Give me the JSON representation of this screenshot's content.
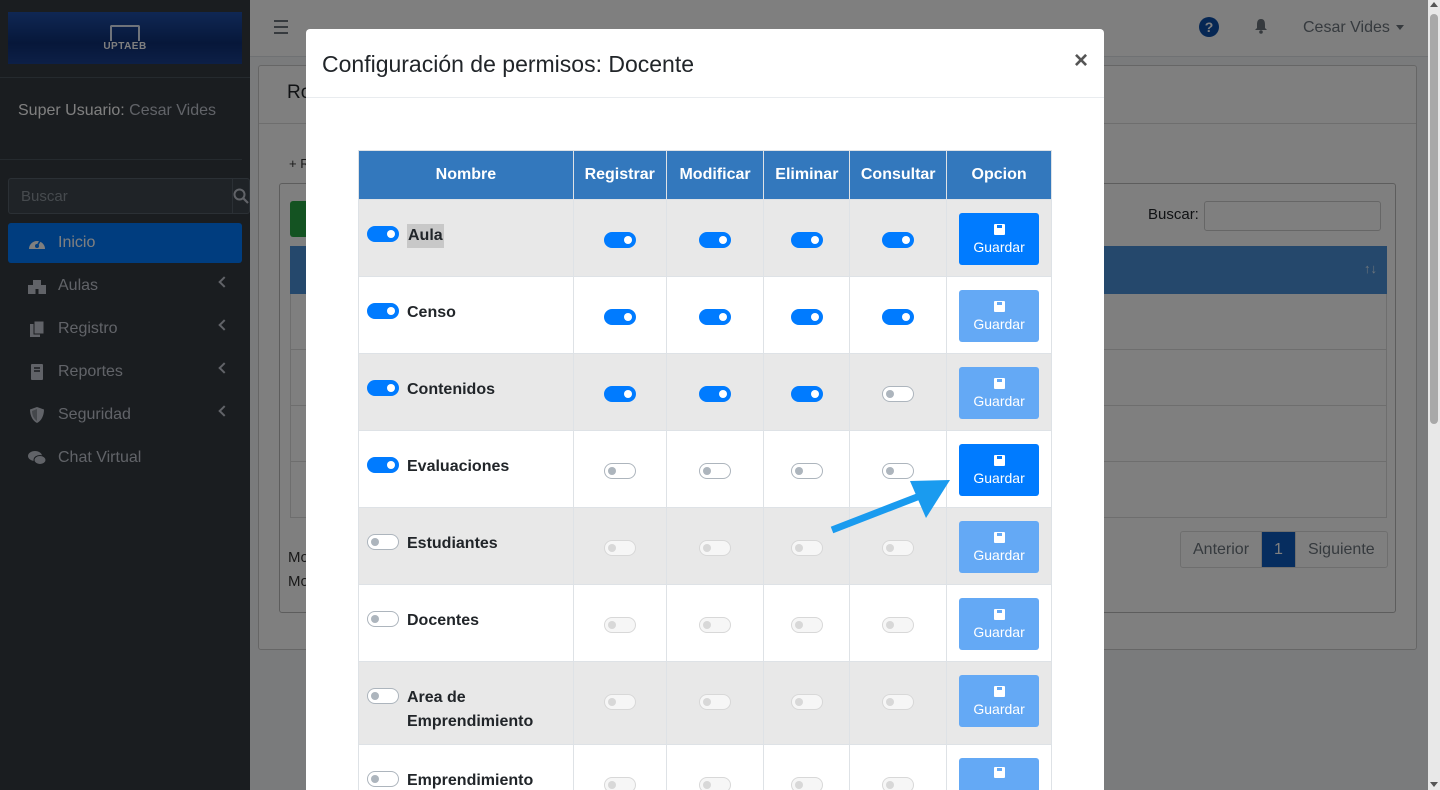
{
  "sidebar": {
    "brand": "UPTAEB",
    "user_role": "Super Usuario:",
    "user_name": "Cesar Vides",
    "search_placeholder": "Buscar",
    "items": [
      {
        "label": "Inicio",
        "icon": "dashboard-icon",
        "active": true
      },
      {
        "label": "Aulas",
        "icon": "school-icon"
      },
      {
        "label": "Registro",
        "icon": "copy-icon"
      },
      {
        "label": "Reportes",
        "icon": "book-icon"
      },
      {
        "label": "Seguridad",
        "icon": "shield-icon"
      },
      {
        "label": "Chat Virtual",
        "icon": "comments-icon"
      }
    ]
  },
  "navbar": {
    "user_name": "Cesar Vides"
  },
  "background": {
    "card_title": "Ro",
    "add_link": "+ R",
    "search_label": "Buscar:",
    "info_lines": [
      "Mo",
      "Mo"
    ],
    "pager": {
      "prev": "Anterior",
      "current": "1",
      "next": "Siguiente"
    }
  },
  "modal": {
    "title": "Configuración de permisos: Docente",
    "close": "×",
    "columns": [
      "Nombre",
      "Registrar",
      "Modificar",
      "Eliminar",
      "Consultar",
      "Opcion"
    ],
    "save_label": "Guardar",
    "rows": [
      {
        "name": "Aula",
        "enabled": "on",
        "perms": [
          "on",
          "on",
          "on",
          "on"
        ],
        "save_active": true,
        "highlight": true
      },
      {
        "name": "Censo",
        "enabled": "on",
        "perms": [
          "on",
          "on",
          "on",
          "on"
        ],
        "save_active": false
      },
      {
        "name": "Contenidos",
        "enabled": "on",
        "perms": [
          "on",
          "on",
          "on",
          "off"
        ],
        "save_active": false
      },
      {
        "name": "Evaluaciones",
        "enabled": "on",
        "perms": [
          "off",
          "off",
          "off",
          "off"
        ],
        "save_active": true
      },
      {
        "name": "Estudiantes",
        "enabled": "off",
        "perms": [
          "dis",
          "dis",
          "dis",
          "dis"
        ],
        "save_active": false
      },
      {
        "name": "Docentes",
        "enabled": "off",
        "perms": [
          "dis",
          "dis",
          "dis",
          "dis"
        ],
        "save_active": false
      },
      {
        "name": "Area de Emprendimiento",
        "enabled": "off",
        "perms": [
          "dis",
          "dis",
          "dis",
          "dis"
        ],
        "save_active": false
      },
      {
        "name": "Emprendimiento",
        "enabled": "off",
        "perms": [
          "dis",
          "dis",
          "dis",
          "dis"
        ],
        "save_active": false
      }
    ]
  },
  "colors": {
    "primary": "#007bff",
    "primary_faded": "#64a9f5",
    "table_header": "#3378bd",
    "sidebar_bg": "#343a40",
    "annotation_arrow": "#1a9bef"
  }
}
